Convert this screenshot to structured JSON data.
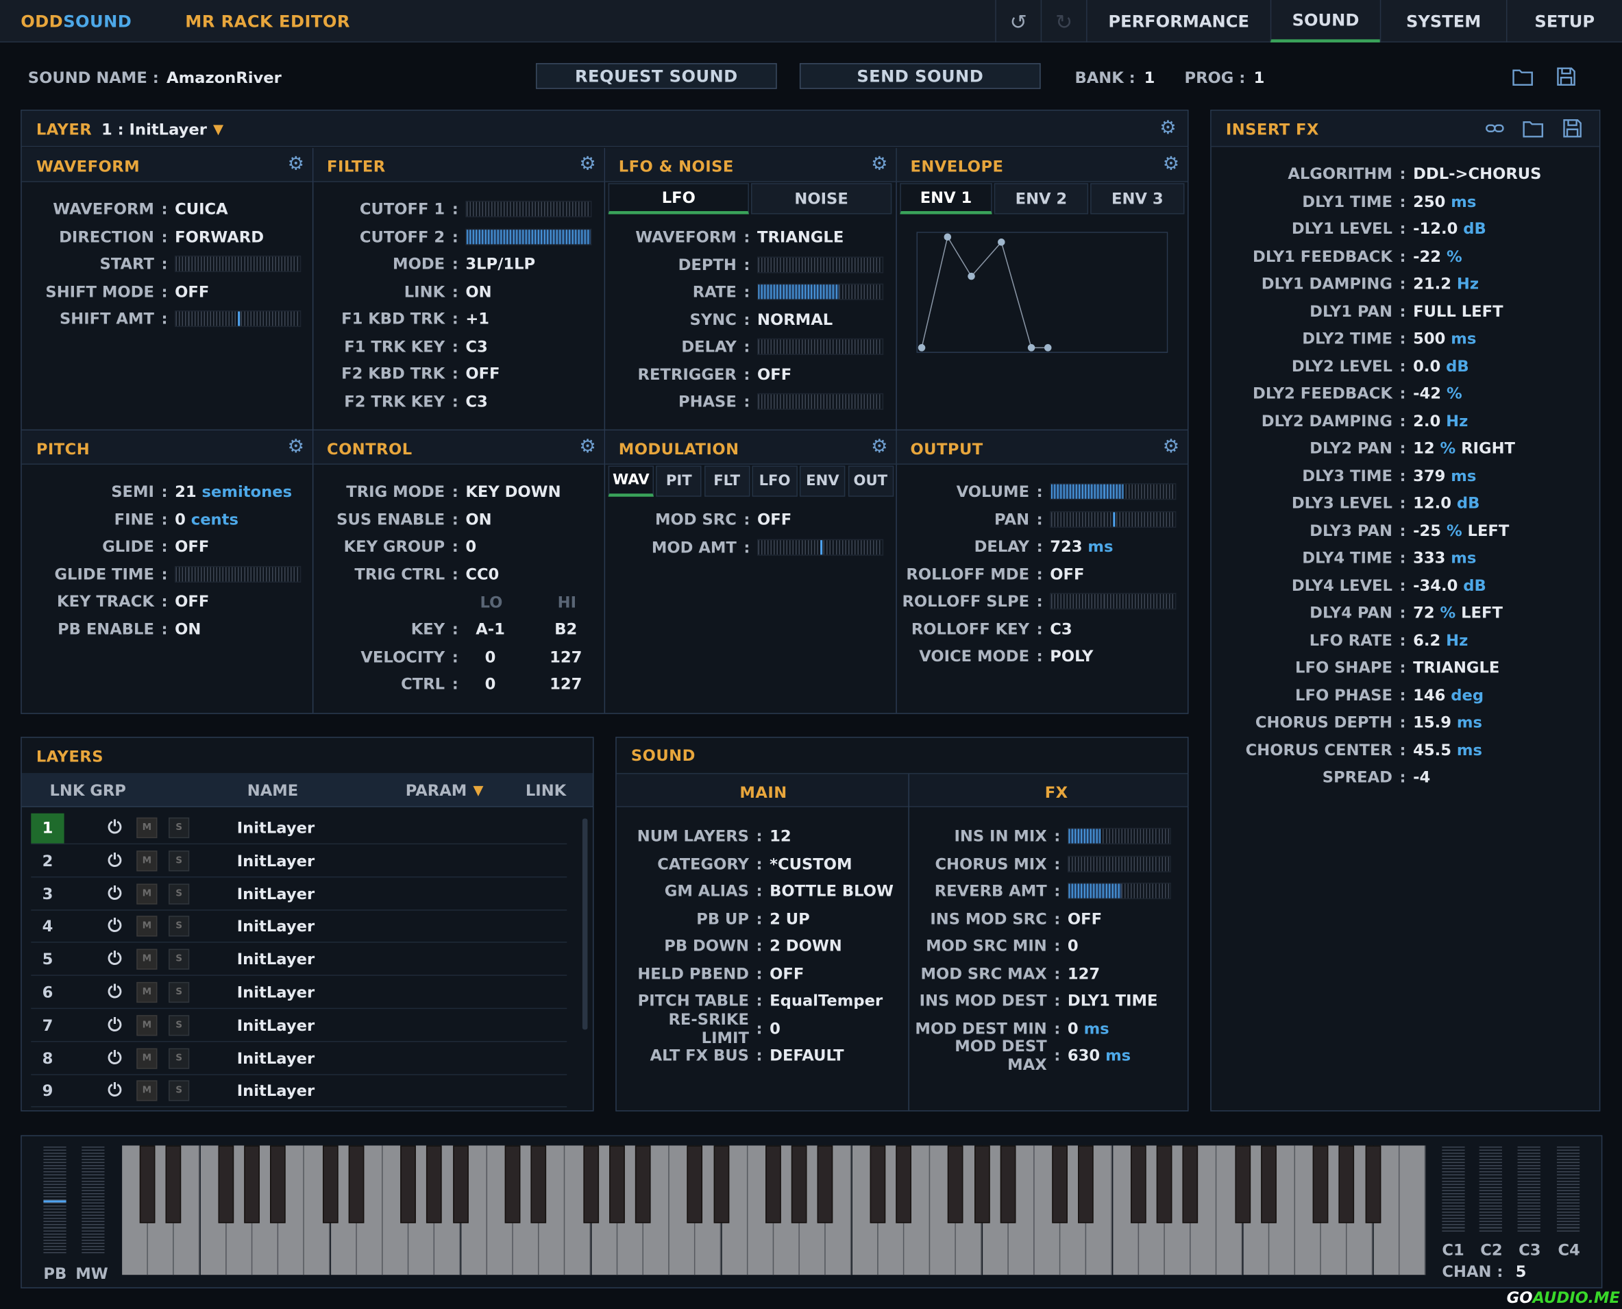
{
  "app": {
    "brand_part1": "ODD",
    "brand_part2": "SOUND",
    "title": "MR RACK EDITOR"
  },
  "nav": {
    "tabs": [
      "PERFORMANCE",
      "SOUND",
      "SYSTEM",
      "SETUP"
    ],
    "active": "SOUND",
    "undo_icon": "undo-icon",
    "redo_icon": "redo-icon"
  },
  "soundbar": {
    "name_label": "SOUND NAME",
    "name_value": "AmazonRiver",
    "request_button": "REQUEST SOUND",
    "send_button": "SEND SOUND",
    "bank_label": "BANK",
    "bank_value": "1",
    "prog_label": "PROG",
    "prog_value": "1",
    "open_icon": "folder-icon",
    "save_icon": "save-icon"
  },
  "layer_header": {
    "label": "LAYER",
    "value": "1 : InitLayer",
    "dropdown_icon": "triangle-down-icon",
    "settings_icon": "gear-icon"
  },
  "waveform": {
    "title": "WAVEFORM",
    "rows": [
      {
        "label": "WAVEFORM",
        "value": "CUICA"
      },
      {
        "label": "DIRECTION",
        "value": "FORWARD"
      },
      {
        "label": "START",
        "slider": 0.0
      },
      {
        "label": "SHIFT MODE",
        "value": "OFF"
      },
      {
        "label": "SHIFT AMT",
        "slider_mark": 0.5
      }
    ]
  },
  "filter": {
    "title": "FILTER",
    "rows": [
      {
        "label": "CUTOFF 1",
        "slider": 0.0
      },
      {
        "label": "CUTOFF 2",
        "slider": 1.0
      },
      {
        "label": "MODE",
        "value": "3LP/1LP"
      },
      {
        "label": "LINK",
        "value": "ON"
      },
      {
        "label": "F1 KBD TRK",
        "value": "+1"
      },
      {
        "label": "F1 TRK KEY",
        "value": "C3"
      },
      {
        "label": "F2 KBD TRK",
        "value": "OFF"
      },
      {
        "label": "F2 TRK KEY",
        "value": "C3"
      }
    ]
  },
  "lfo": {
    "title": "LFO & NOISE",
    "tabs": [
      "LFO",
      "NOISE"
    ],
    "rows": [
      {
        "label": "WAVEFORM",
        "value": "TRIANGLE"
      },
      {
        "label": "DEPTH",
        "slider": 0.0
      },
      {
        "label": "RATE",
        "slider": 0.65
      },
      {
        "label": "SYNC",
        "value": "NORMAL"
      },
      {
        "label": "DELAY",
        "slider": 0.0
      },
      {
        "label": "RETRIGGER",
        "value": "OFF"
      },
      {
        "label": "PHASE",
        "slider": 0.0
      }
    ]
  },
  "envelope": {
    "title": "ENVELOPE",
    "tabs": [
      "ENV 1",
      "ENV 2",
      "ENV 3"
    ]
  },
  "pitch": {
    "title": "PITCH",
    "rows": [
      {
        "label": "SEMI",
        "num": "21",
        "unit": "semitones"
      },
      {
        "label": "FINE",
        "num": "0",
        "unit": "cents"
      },
      {
        "label": "GLIDE",
        "value": "OFF"
      },
      {
        "label": "GLIDE TIME",
        "slider": 0.0
      },
      {
        "label": "KEY TRACK",
        "value": "OFF"
      },
      {
        "label": "PB ENABLE",
        "value": "ON"
      }
    ]
  },
  "control": {
    "title": "CONTROL",
    "rows": [
      {
        "label": "TRIG MODE",
        "value": "KEY DOWN"
      },
      {
        "label": "SUS ENABLE",
        "value": "ON"
      },
      {
        "label": "KEY GROUP",
        "value": "0"
      },
      {
        "label": "TRIG CTRL",
        "value": "CC0"
      }
    ],
    "range_headers": [
      "LO",
      "HI"
    ],
    "ranges": [
      {
        "label": "KEY",
        "lo": "A-1",
        "hi": "B2"
      },
      {
        "label": "VELOCITY",
        "lo": "0",
        "hi": "127"
      },
      {
        "label": "CTRL",
        "lo": "0",
        "hi": "127"
      }
    ]
  },
  "modulation": {
    "title": "MODULATION",
    "tabs": [
      "WAV",
      "PIT",
      "FLT",
      "LFO",
      "ENV",
      "OUT"
    ],
    "rows": [
      {
        "label": "MOD SRC",
        "value": "OFF"
      },
      {
        "label": "MOD AMT",
        "slider_mark": 0.5
      }
    ]
  },
  "output": {
    "title": "OUTPUT",
    "rows": [
      {
        "label": "VOLUME",
        "slider": 0.58
      },
      {
        "label": "PAN",
        "slider_mark": 0.5
      },
      {
        "label": "DELAY",
        "num": "723",
        "unit": "ms"
      },
      {
        "label": "ROLLOFF MDE",
        "value": "OFF"
      },
      {
        "label": "ROLLOFF SLPE",
        "slider": 0.0
      },
      {
        "label": "ROLLOFF KEY",
        "value": "C3"
      },
      {
        "label": "VOICE MODE",
        "value": "POLY"
      }
    ]
  },
  "insert_fx": {
    "title": "INSERT FX",
    "link_icon": "link-icon",
    "open_icon": "folder-icon",
    "save_icon": "save-icon",
    "rows": [
      {
        "label": "ALGORITHM",
        "value": "DDL->CHORUS"
      },
      {
        "label": "DLY1 TIME",
        "num": "250",
        "unit": "ms"
      },
      {
        "label": "DLY1 LEVEL",
        "num": "-12.0",
        "unit": "dB"
      },
      {
        "label": "DLY1 FEEDBACK",
        "num": "-22",
        "unit": "%"
      },
      {
        "label": "DLY1 DAMPING",
        "num": "21.2",
        "unit": "Hz"
      },
      {
        "label": "DLY1 PAN",
        "value": "FULL LEFT"
      },
      {
        "label": "DLY2 TIME",
        "num": "500",
        "unit": "ms"
      },
      {
        "label": "DLY2 LEVEL",
        "num": "0.0",
        "unit": "dB"
      },
      {
        "label": "DLY2 FEEDBACK",
        "num": "-42",
        "unit": "%"
      },
      {
        "label": "DLY2 DAMPING",
        "num": "2.0",
        "unit": "Hz"
      },
      {
        "label": "DLY2 PAN",
        "num": "12",
        "unit": "%",
        "suffix": "RIGHT"
      },
      {
        "label": "DLY3 TIME",
        "num": "379",
        "unit": "ms"
      },
      {
        "label": "DLY3 LEVEL",
        "num": "12.0",
        "unit": "dB"
      },
      {
        "label": "DLY3 PAN",
        "num": "-25",
        "unit": "%",
        "suffix": "LEFT"
      },
      {
        "label": "DLY4 TIME",
        "num": "333",
        "unit": "ms"
      },
      {
        "label": "DLY4 LEVEL",
        "num": "-34.0",
        "unit": "dB"
      },
      {
        "label": "DLY4 PAN",
        "num": "72",
        "unit": "%",
        "suffix": "LEFT"
      },
      {
        "label": "LFO RATE",
        "num": "6.2",
        "unit": "Hz"
      },
      {
        "label": "LFO SHAPE",
        "value": "TRIANGLE"
      },
      {
        "label": "LFO PHASE",
        "num": "146",
        "unit": "deg"
      },
      {
        "label": "CHORUS DEPTH",
        "num": "15.9",
        "unit": "ms"
      },
      {
        "label": "CHORUS CENTER",
        "num": "45.5",
        "unit": "ms"
      },
      {
        "label": "SPREAD",
        "value": "-4"
      }
    ]
  },
  "layers": {
    "title": "LAYERS",
    "columns": [
      "LNK GRP",
      "NAME",
      "PARAM",
      "LINK"
    ],
    "mute_label": "M",
    "solo_label": "S",
    "power_icon": "power-icon",
    "rows": [
      {
        "num": "1",
        "name": "InitLayer"
      },
      {
        "num": "2",
        "name": "InitLayer"
      },
      {
        "num": "3",
        "name": "InitLayer"
      },
      {
        "num": "4",
        "name": "InitLayer"
      },
      {
        "num": "5",
        "name": "InitLayer"
      },
      {
        "num": "6",
        "name": "InitLayer"
      },
      {
        "num": "7",
        "name": "InitLayer"
      },
      {
        "num": "8",
        "name": "InitLayer"
      },
      {
        "num": "9",
        "name": "InitLayer"
      }
    ]
  },
  "sound": {
    "title": "SOUND",
    "main_tab": "MAIN",
    "fx_tab": "FX",
    "main_rows": [
      {
        "label": "NUM LAYERS",
        "value": "12"
      },
      {
        "label": "CATEGORY",
        "value": "*CUSTOM"
      },
      {
        "label": "GM ALIAS",
        "value": "BOTTLE BLOW"
      },
      {
        "label": "PB UP",
        "value": "2 UP"
      },
      {
        "label": "PB DOWN",
        "value": "2 DOWN"
      },
      {
        "label": "HELD PBEND",
        "value": "OFF"
      },
      {
        "label": "PITCH TABLE",
        "value": "EqualTemper"
      },
      {
        "label": "RE-SRIKE LIMIT",
        "value": "0"
      },
      {
        "label": "ALT FX BUS",
        "value": "DEFAULT"
      }
    ],
    "fx_rows": [
      {
        "label": "INS IN MIX",
        "slider": 0.32
      },
      {
        "label": "CHORUS MIX",
        "slider": 0.0
      },
      {
        "label": "REVERB AMT",
        "slider": 0.52
      },
      {
        "label": "INS MOD SRC",
        "value": "OFF"
      },
      {
        "label": "MOD SRC MIN",
        "value": "0"
      },
      {
        "label": "MOD SRC MAX",
        "value": "127"
      },
      {
        "label": "INS MOD DEST",
        "value": "DLY1 TIME"
      },
      {
        "label": "MOD DEST MIN",
        "num": "0",
        "unit": "ms"
      },
      {
        "label": "MOD DEST MAX",
        "num": "630",
        "unit": "ms"
      }
    ]
  },
  "keyboard": {
    "pb_label": "PB",
    "mw_label": "MW",
    "cc_labels": [
      "C1",
      "C2",
      "C3",
      "C4"
    ],
    "chan_label": "CHAN",
    "chan_value": "5"
  },
  "watermark": {
    "part1": "GO",
    "part2": "AUDIO.ME"
  },
  "colors": {
    "accent_orange": "#e8a63c",
    "accent_blue": "#4da8e8",
    "active_green": "#3aa35a",
    "background": "#0a0e14"
  }
}
